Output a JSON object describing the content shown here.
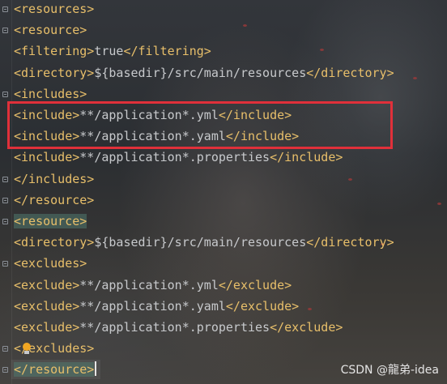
{
  "colors": {
    "tag": "#e8bf6a",
    "text": "#c7c9cc",
    "highlight_box": "#e0303a",
    "match_highlight": "#4f786e"
  },
  "editor": {
    "lines": [
      {
        "open": "<resources>",
        "content": "",
        "close": ""
      },
      {
        "open": "<resource>",
        "content": "",
        "close": ""
      },
      {
        "open": "<filtering>",
        "content": "true",
        "close": "</filtering>"
      },
      {
        "open": "<directory>",
        "content": "${basedir}/src/main/resources",
        "close": "</directory>"
      },
      {
        "open": "<includes>",
        "content": "",
        "close": ""
      },
      {
        "open": "<include>",
        "content": "**/application*.yml",
        "close": "</include>"
      },
      {
        "open": "<include>",
        "content": "**/application*.yaml",
        "close": "</include>"
      },
      {
        "open": "<include>",
        "content": "**/application*.properties",
        "close": "</include>"
      },
      {
        "open": "</includes>",
        "content": "",
        "close": ""
      },
      {
        "open": "</resource>",
        "content": "",
        "close": ""
      },
      {
        "open": "<resource>",
        "content": "",
        "close": ""
      },
      {
        "open": "<directory>",
        "content": "${basedir}/src/main/resources",
        "close": "</directory>"
      },
      {
        "open": "<excludes>",
        "content": "",
        "close": ""
      },
      {
        "open": "<exclude>",
        "content": "**/application*.yml",
        "close": "</exclude>"
      },
      {
        "open": "<exclude>",
        "content": "**/application*.yaml",
        "close": "</exclude>"
      },
      {
        "open": "<exclude>",
        "content": "**/application*.properties",
        "close": "</exclude>"
      },
      {
        "open": "</excludes>",
        "content": "",
        "close": ""
      },
      {
        "open": "</resource>",
        "content": "",
        "close": ""
      }
    ],
    "matched_tag_lines": [
      10,
      17
    ],
    "highlighted_lines": [
      5,
      6
    ],
    "caret_line": 17,
    "intention_icon": "lightbulb-icon"
  },
  "watermark": "CSDN @龍弟-idea"
}
